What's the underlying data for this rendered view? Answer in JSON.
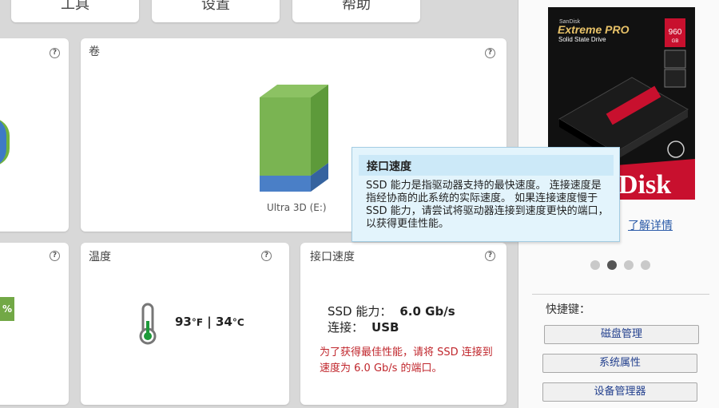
{
  "top_tabs": [
    {
      "label": "工具"
    },
    {
      "label": "设置"
    },
    {
      "label": "帮助"
    }
  ],
  "cards": {
    "left_top": {
      "help": "?"
    },
    "volume": {
      "title": "卷",
      "help": "?",
      "drive_label": "Ultra 3D (E:)"
    },
    "left_bottom": {
      "help": "?",
      "badge": "%"
    },
    "temperature": {
      "title": "温度",
      "help": "?",
      "fahrenheit": "93",
      "f_unit": "°F",
      "separator": " | ",
      "celsius": "34",
      "c_unit": "°C"
    },
    "interface": {
      "title": "接口速度",
      "help": "?",
      "ssd_label": "SSD 能力：",
      "ssd_value": "6.0 Gb/s",
      "conn_label": "连接：",
      "conn_value": "USB",
      "note": "为了获得最佳性能，请将 SSD 连接到速度为 6.0 Gb/s 的端口。"
    }
  },
  "tooltip": {
    "title": "接口速度",
    "text": "SSD 能力是指驱动器支持的最快速度。 连接速度是指经协商的此系统的实际速度。 如果连接速度慢于 SSD 能力，请尝试将驱动器连接到速度更快的端口，以获得更佳性能。"
  },
  "product": {
    "brand": "SanDisk",
    "model": "Extreme PRO",
    "subtitle": "Solid State Drive",
    "capacity": "960",
    "capacity_unit": "GB",
    "big_logo": "Disk",
    "learn_more": "了解详情"
  },
  "carousel": {
    "count": 4,
    "active_index": 1
  },
  "shortcuts": {
    "label": "快捷键：",
    "buttons": [
      {
        "label": "磁盘管理"
      },
      {
        "label": "系统属性"
      },
      {
        "label": "设备管理器"
      }
    ]
  },
  "colors": {
    "volume_used": "#4a7fc7",
    "volume_free": "#7ab452",
    "note_red": "#c0262c",
    "link_blue": "#2a5aa8",
    "tooltip_bg": "#e3f4fc"
  }
}
